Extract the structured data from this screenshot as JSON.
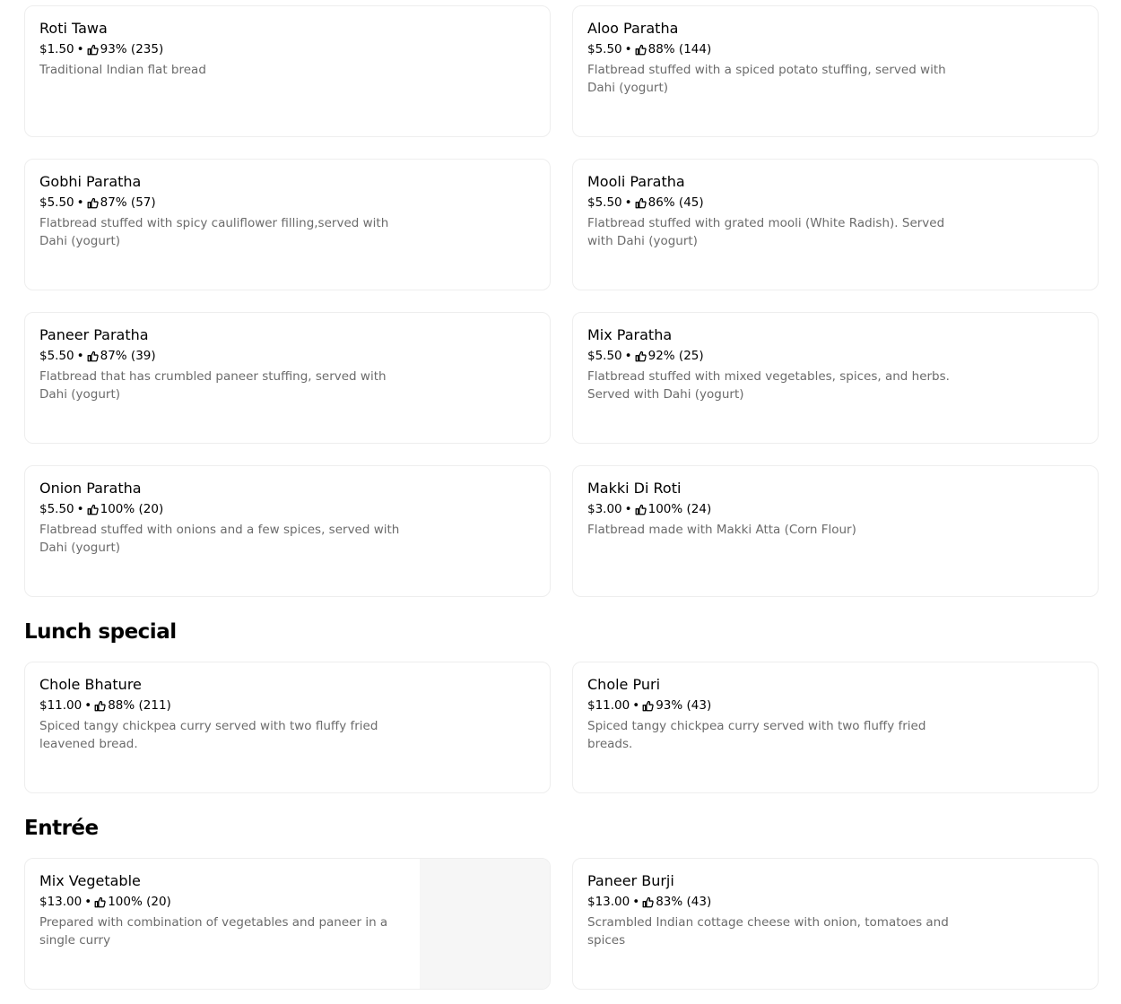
{
  "sections": [
    {
      "title": "",
      "items": [
        {
          "name": "Roti Tawa",
          "price": "$1.50",
          "rating": "93% (235)",
          "description": "Traditional Indian flat bread"
        },
        {
          "name": "Aloo Paratha",
          "price": "$5.50",
          "rating": "88% (144)",
          "description": "Flatbread stuffed with a spiced potato stuffing, served with Dahi (yogurt)"
        },
        {
          "name": "Gobhi Paratha",
          "price": "$5.50",
          "rating": "87% (57)",
          "description": "Flatbread stuffed with spicy cauliflower filling,served with Dahi (yogurt)"
        },
        {
          "name": "Mooli Paratha",
          "price": "$5.50",
          "rating": "86% (45)",
          "description": "Flatbread stuffed with grated mooli (White Radish). Served with Dahi (yogurt)"
        },
        {
          "name": "Paneer Paratha",
          "price": "$5.50",
          "rating": "87% (39)",
          "description": "Flatbread that has crumbled paneer stuffing, served with Dahi (yogurt)"
        },
        {
          "name": "Mix Paratha",
          "price": "$5.50",
          "rating": "92% (25)",
          "description": "Flatbread stuffed with mixed vegetables, spices, and herbs. Served with Dahi (yogurt)"
        },
        {
          "name": "Onion Paratha",
          "price": "$5.50",
          "rating": "100% (20)",
          "description": "Flatbread stuffed with onions and a few spices, served with Dahi (yogurt)"
        },
        {
          "name": "Makki Di Roti",
          "price": "$3.00",
          "rating": "100% (24)",
          "description": "Flatbread made with Makki Atta (Corn Flour)"
        }
      ]
    },
    {
      "title": "Lunch special",
      "items": [
        {
          "name": "Chole Bhature",
          "price": "$11.00",
          "rating": "88% (211)",
          "description": "Spiced tangy chickpea curry served with two fluffy fried leavened bread."
        },
        {
          "name": "Chole Puri",
          "price": "$11.00",
          "rating": "93% (43)",
          "description": "Spiced tangy chickpea curry served with two fluffy fried breads."
        }
      ]
    },
    {
      "title": "Entrée",
      "items": [
        {
          "name": "Mix Vegetable",
          "price": "$13.00",
          "rating": "100% (20)",
          "description": "Prepared with combination of vegetables and paneer in a single curry"
        },
        {
          "name": "Paneer Burji",
          "price": "$13.00",
          "rating": "83% (43)",
          "description": "Scrambled Indian cottage cheese with onion, tomatoes and spices"
        }
      ]
    }
  ],
  "separator": "•",
  "icons": {
    "rating": "thumbs-up-icon"
  },
  "colors": {
    "text": "#000000",
    "description": "#6b6b6b",
    "border": "#eeeeee",
    "image_placeholder": "#f6f6f6"
  }
}
